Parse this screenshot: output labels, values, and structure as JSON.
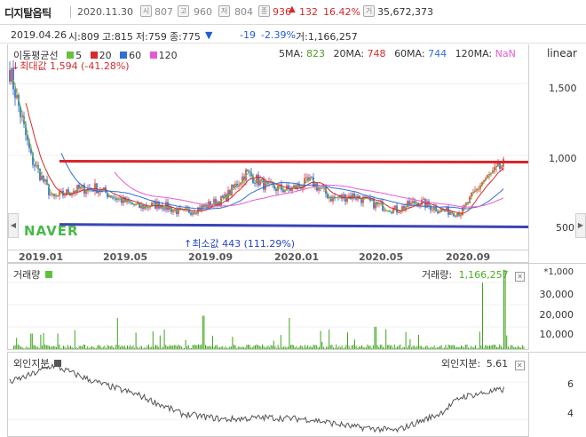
{
  "header": {
    "stock_name": "디지탈옵틱",
    "date": "2020.11.30",
    "open_icon": "시",
    "open": "807",
    "high_icon": "고",
    "high": "960",
    "low_icon": "저",
    "low": "804",
    "close_icon": "종",
    "close": "936",
    "change": "132",
    "change_pct": "16.42%",
    "volume_icon": "거",
    "volume": "35,672,373"
  },
  "infobar": {
    "date": "2019.04.26",
    "open": "시:809",
    "high": "고:815",
    "low": "저:759",
    "close": "종:775",
    "change": "-19",
    "change_pct": "-2.39%",
    "volume": "거:1,166,257"
  },
  "price_chart": {
    "scale": "linear",
    "ma_title": "이동평균선",
    "ma_items": [
      {
        "label": "5",
        "color": "#6bbf3b"
      },
      {
        "label": "20",
        "color": "#d62b2b"
      },
      {
        "label": "60",
        "color": "#2f6fd6"
      },
      {
        "label": "120",
        "color": "#e65ad1"
      }
    ],
    "ma_values": [
      {
        "label": "5MA:",
        "value": "823",
        "color": "#4f9d22"
      },
      {
        "label": "20MA:",
        "value": "748",
        "color": "#d62b2b"
      },
      {
        "label": "60MA:",
        "value": "744",
        "color": "#2f6fd6"
      },
      {
        "label": "120MA:",
        "value": "NaN",
        "color": "#e65ad1"
      }
    ],
    "max_label": "최대값 1,594 (-41.28%)",
    "min_label": "최소값 443 (111.29%)",
    "watermark": "NAVER",
    "y_ticks": [
      "1,500",
      "1,000",
      "500"
    ],
    "x_ticks": [
      "2019.01",
      "2019.05",
      "2019.09",
      "2020.01",
      "2020.05",
      "2020.09"
    ]
  },
  "volume_panel": {
    "title": "거래량",
    "color": "#4caf1f",
    "legend_label": "거래량:",
    "legend_value": "1,166,257",
    "unit": "*1,000",
    "y_ticks": [
      "30,000",
      "20,000",
      "10,000"
    ]
  },
  "foreign_panel": {
    "title": "외인지분",
    "color": "#555555",
    "legend_label": "외인지분:",
    "legend_value": "5.61",
    "y_ticks": [
      "6",
      "4"
    ]
  },
  "chart_data": [
    {
      "type": "candlestick",
      "title": "",
      "x_range": [
        "2018.12",
        "2020.11"
      ],
      "ylim": [
        400,
        1650
      ],
      "resistance_level": 960,
      "support_level": 520,
      "approx_close_path": [
        {
          "x": "2018.12",
          "y": 1594
        },
        {
          "x": "2019.01",
          "y": 980
        },
        {
          "x": "2019.02",
          "y": 700
        },
        {
          "x": "2019.03",
          "y": 760
        },
        {
          "x": "2019.04",
          "y": 775
        },
        {
          "x": "2019.05",
          "y": 700
        },
        {
          "x": "2019.06",
          "y": 640
        },
        {
          "x": "2019.07",
          "y": 660
        },
        {
          "x": "2019.08",
          "y": 600
        },
        {
          "x": "2019.09",
          "y": 640
        },
        {
          "x": "2019.10",
          "y": 700
        },
        {
          "x": "2019.11",
          "y": 880
        },
        {
          "x": "2019.12",
          "y": 780
        },
        {
          "x": "2020.01",
          "y": 760
        },
        {
          "x": "2020.02",
          "y": 820
        },
        {
          "x": "2020.03",
          "y": 700
        },
        {
          "x": "2020.04",
          "y": 720
        },
        {
          "x": "2020.05",
          "y": 660
        },
        {
          "x": "2020.06",
          "y": 620
        },
        {
          "x": "2020.07",
          "y": 680
        },
        {
          "x": "2020.08",
          "y": 620
        },
        {
          "x": "2020.09",
          "y": 600
        },
        {
          "x": "2020.10",
          "y": 820
        },
        {
          "x": "2020.11",
          "y": 936
        }
      ]
    },
    {
      "type": "bar",
      "title": "거래량",
      "unit": "*1,000",
      "ylim": [
        0,
        36000
      ],
      "peaks": [
        {
          "x": "2019.01",
          "y": 7000
        },
        {
          "x": "2019.05",
          "y": 14000
        },
        {
          "x": "2019.09",
          "y": 15000
        },
        {
          "x": "2020.01",
          "y": 14000
        },
        {
          "x": "2020.05",
          "y": 10000
        },
        {
          "x": "2020.10",
          "y": 30000
        },
        {
          "x": "2020.11",
          "y": 35672
        }
      ]
    },
    {
      "type": "line",
      "title": "외인지분",
      "ylim": [
        3.2,
        7.2
      ],
      "approx_path": [
        {
          "x": "2018.12",
          "y": 6.0
        },
        {
          "x": "2019.01",
          "y": 6.4
        },
        {
          "x": "2019.02",
          "y": 6.9
        },
        {
          "x": "2019.04",
          "y": 6.0
        },
        {
          "x": "2019.06",
          "y": 5.3
        },
        {
          "x": "2019.08",
          "y": 4.3
        },
        {
          "x": "2019.10",
          "y": 4.0
        },
        {
          "x": "2019.12",
          "y": 4.1
        },
        {
          "x": "2020.02",
          "y": 4.0
        },
        {
          "x": "2020.04",
          "y": 3.6
        },
        {
          "x": "2020.06",
          "y": 3.4
        },
        {
          "x": "2020.08",
          "y": 4.3
        },
        {
          "x": "2020.09",
          "y": 5.2
        },
        {
          "x": "2020.11",
          "y": 5.61
        }
      ]
    }
  ]
}
